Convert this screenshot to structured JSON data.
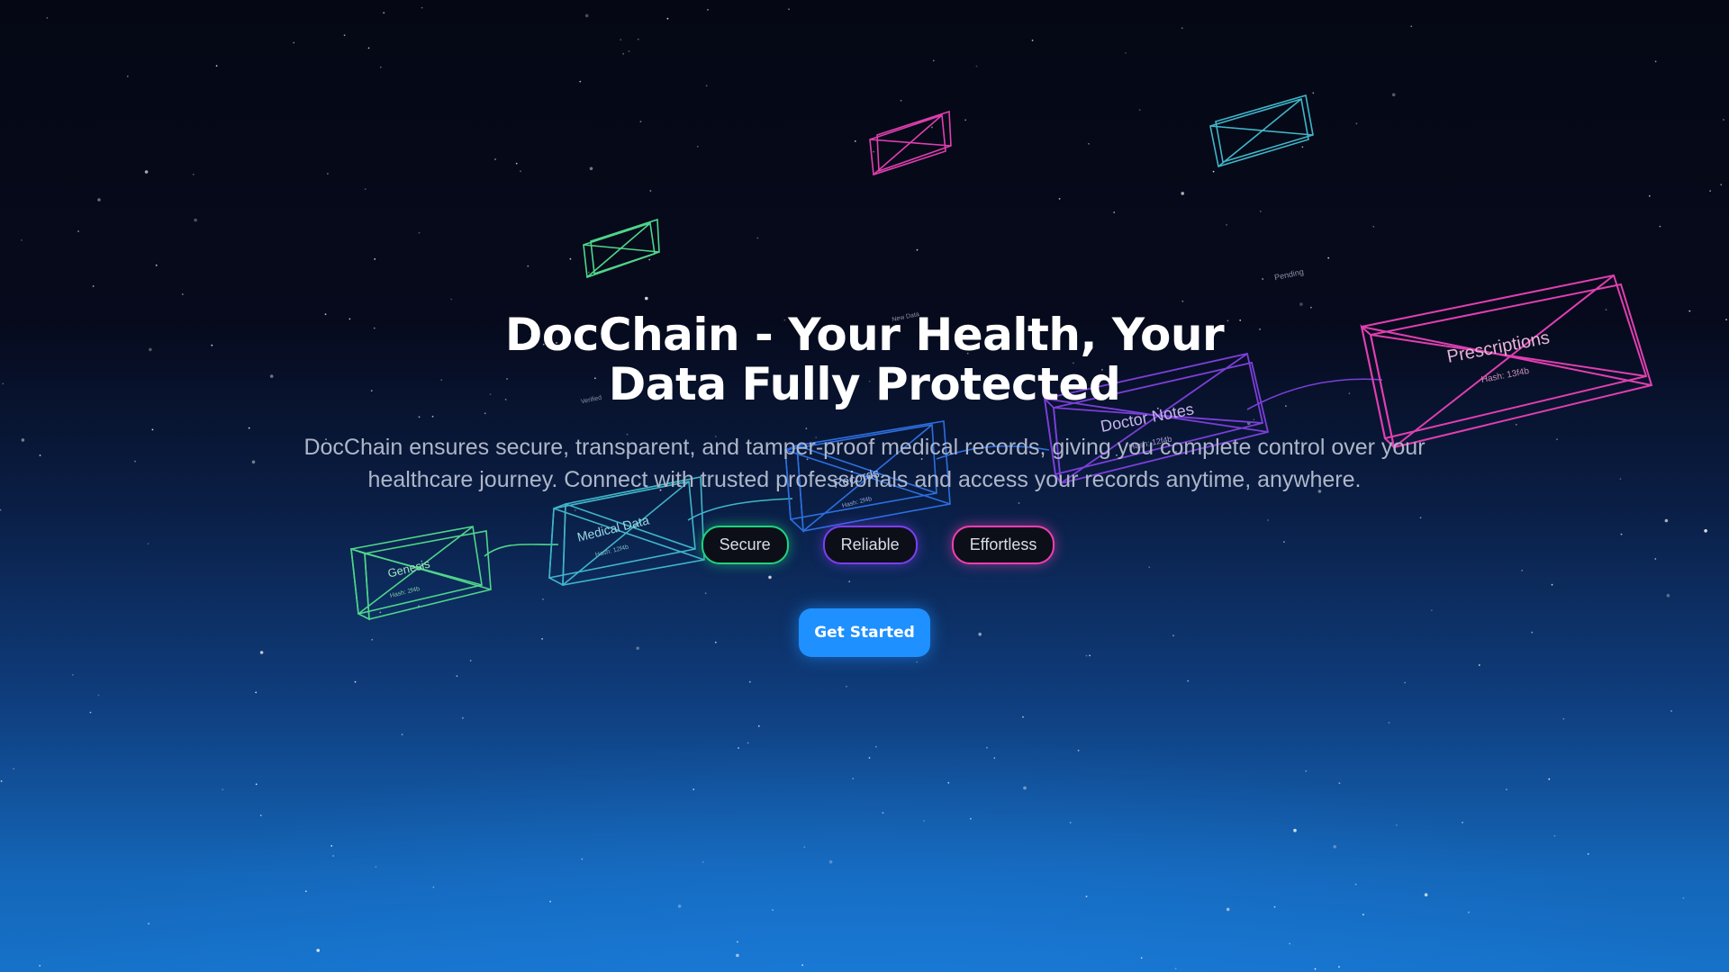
{
  "hero": {
    "title": "DocChain - Your Health, Your Data Fully Protected",
    "description": "DocChain ensures secure, transparent, and tamper-proof medical records, giving you complete control over your healthcare journey. Connect with trusted professionals and access your records anytime, anywhere."
  },
  "tags": [
    {
      "label": "Secure",
      "color": "#1fd37c"
    },
    {
      "label": "Reliable",
      "color": "#7b3ff0"
    },
    {
      "label": "Effortless",
      "color": "#f03fb0"
    }
  ],
  "cta": {
    "label": "Get Started",
    "color": "#1e90ff"
  },
  "blockchain": {
    "blocks": [
      {
        "label": "Genesis",
        "hash": "Hash: 2f4b",
        "color": "#4fd68a"
      },
      {
        "label": "Medical Data",
        "hash": "Hash: 12f4b",
        "color": "#3fb6c9"
      },
      {
        "label": "Records",
        "hash": "Hash: 2f4b",
        "color": "#2d6fe0"
      },
      {
        "label": "Doctor Notes",
        "hash": "Hash: 12f4b",
        "color": "#7b3fd8"
      },
      {
        "label": "Prescriptions",
        "hash": "Hash: 13f4b",
        "color": "#e03fb0"
      }
    ],
    "floating_labels": [
      "Pending",
      "New Data",
      "Verified"
    ]
  }
}
